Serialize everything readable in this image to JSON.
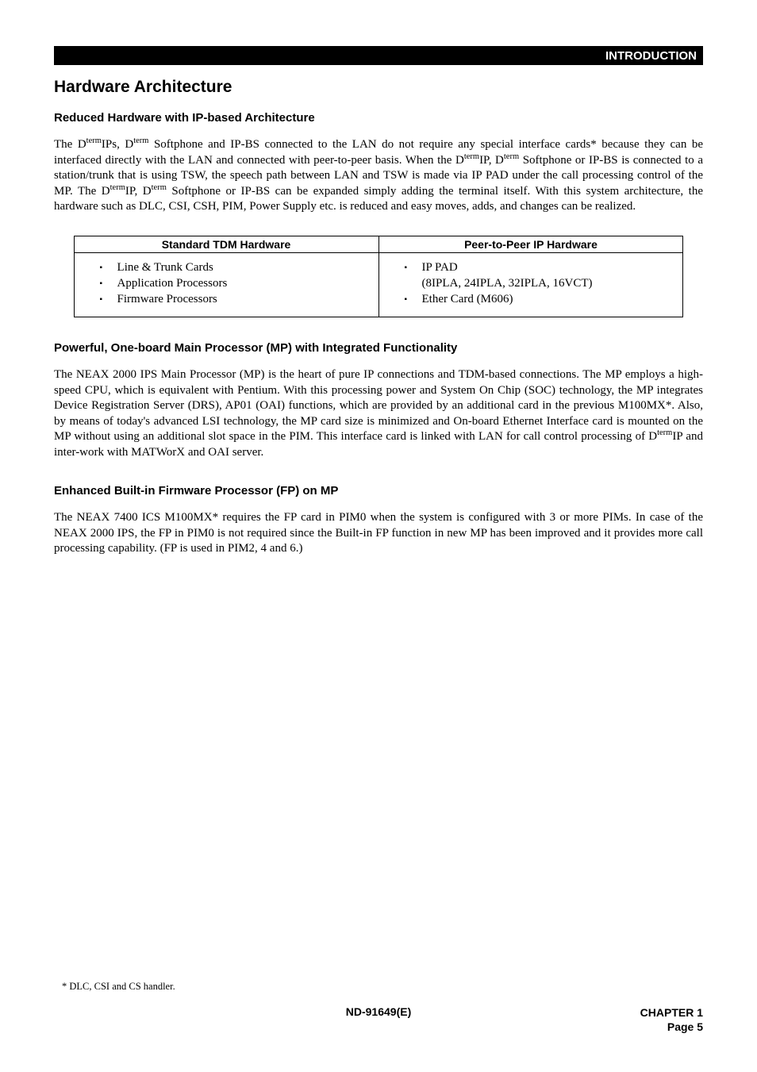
{
  "header": {
    "banner": "INTRODUCTION"
  },
  "title": "Hardware Architecture",
  "sec1": {
    "heading": "Reduced Hardware with IP-based Architecture",
    "p1a": "The D",
    "p1b": "IPs, D",
    "p1c": " Softphone and IP-BS connected to the LAN do not require any special interface cards* because they can be interfaced directly with the LAN and connected with peer-to-peer basis.  When the D",
    "p1d": "IP, D",
    "p1e": " Softphone or IP-BS is connected to a station/trunk that is using TSW, the speech path between LAN and TSW is made via IP PAD under the call processing control of the MP.  The D",
    "p1f": "IP, D",
    "p1g": " Softphone or IP-BS can be expanded simply adding the terminal itself.  With this system architecture, the hardware such as DLC, CSI, CSH, PIM, Power Supply etc. is reduced and easy moves, adds, and changes can be realized."
  },
  "table": {
    "h1": "Standard TDM Hardware",
    "h2": "Peer-to-Peer IP Hardware",
    "left": [
      "Line & Trunk Cards",
      "Application Processors",
      "Firmware Processors"
    ],
    "right": {
      "i1": "IP PAD",
      "i1sub": "(8IPLA, 24IPLA, 32IPLA, 16VCT)",
      "i2": "Ether Card (M606)"
    }
  },
  "sec2": {
    "heading": "Powerful, One-board Main Processor (MP) with Integrated Functionality",
    "p1": "The NEAX 2000 IPS Main Processor (MP) is the heart of pure IP connections and TDM-based connections.  The MP employs a high-speed CPU, which is equivalent with Pentium.  With this processing power and System On Chip (SOC) technology, the MP integrates Device Registration Server (DRS), AP01 (OAI) functions, which are provided by an additional card in the previous M100MX*.   Also, by means of today's advanced LSI technology, the MP card size is minimized and On-board Ethernet Interface card is mounted on the MP without using an additional slot space in the PIM.  This interface card is linked with LAN for call control processing of D",
    "p1b": "IP and inter-work with MATWorX and OAI server."
  },
  "sec3": {
    "heading": "Enhanced Built-in Firmware Processor (FP) on MP",
    "p1": "The NEAX 7400 ICS M100MX* requires the FP card in PIM0 when the system is configured with 3 or more PIMs.  In case of the NEAX 2000 IPS, the FP in PIM0 is not required since the Built-in FP function in new MP has been improved and it provides more call processing capability.  (FP is used in PIM2, 4 and 6.)"
  },
  "sup": "term",
  "footnote": "*  DLC, CSI and CS handler.",
  "footer": {
    "doc": "ND-91649(E)",
    "chapter": "CHAPTER 1",
    "page": "Page 5"
  }
}
